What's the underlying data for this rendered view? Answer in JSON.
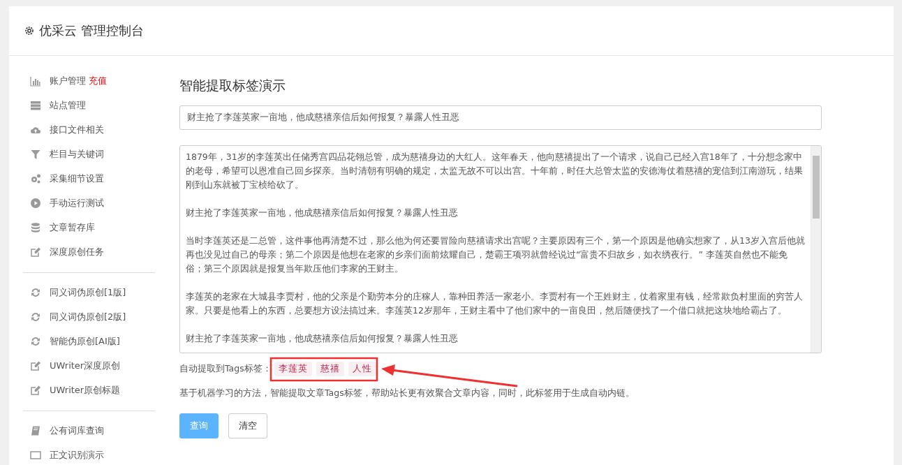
{
  "header": {
    "title": "优采云 管理控制台"
  },
  "sidebar": {
    "groups": [
      [
        {
          "label": "账户管理",
          "badge": "充值"
        },
        {
          "label": "站点管理"
        },
        {
          "label": "接口文件相关"
        },
        {
          "label": "栏目与关键词"
        },
        {
          "label": "采集细节设置"
        },
        {
          "label": "手动运行测试"
        },
        {
          "label": "文章暂存库"
        },
        {
          "label": "深度原创任务"
        }
      ],
      [
        {
          "label": "同义词伪原创[1版]"
        },
        {
          "label": "同义词伪原创[2版]"
        },
        {
          "label": "智能伪原创[AI版]"
        },
        {
          "label": "UWriter深度原创"
        },
        {
          "label": "UWriter原创标题"
        }
      ],
      [
        {
          "label": "公有词库查询"
        },
        {
          "label": "正文识别演示"
        }
      ]
    ]
  },
  "main": {
    "heading": "智能提取标签演示",
    "title_field": {
      "value": "财主抢了李莲英家一亩地，他成慈禧亲信后如何报复？暴露人性丑恶"
    },
    "content_field": {
      "paragraphs": [
        "1879年，31岁的李莲英出任储秀宫四品花翎总管，成为慈禧身边的大红人。这年春天，他向慈禧提出了一个请求，说自己已经入宫18年了，十分想念家中的老母，希望可以恩准自己回乡探亲。当时清朝有明确的规定，太监无故不可以出宫。十年前，时任大总管太监的安德海仗着慈禧的宠信到江南游玩，结果刚到山东就被丁宝桢给砍了。",
        "财主抢了李莲英家一亩地，他成慈禧亲信后如何报复？暴露人性丑恶",
        "当时李莲英还是二总管，这件事他再清楚不过，那么他为何还要冒险向慈禧请求出宫呢？主要原因有三个，第一个原因是他确实想家了，从13岁入宫后他就再也没见过自己的母亲；第二个原因是他想在老家的乡亲们面前炫耀自己，楚霸王项羽就曾经说过“富贵不归故乡，如衣绣夜行。” 李莲英自然也不能免俗；第三个原因就是报复当年欺压他们李家的王财主。",
        "李莲英的老家在大城县李贾村，他的父亲是个勤劳本分的庄稼人，靠种田养活一家老小。李贾村有一个王姓财主，仗着家里有钱，经常欺负村里面的穷苦人家。只要是他看上的东西，总要想方设法搞过来。李莲英12岁那年，王财主看中了他们家中的一亩良田，然后随便找了一个借口就把这块地给霸占了。",
        "财主抢了李莲英家一亩地，他成慈禧亲信后如何报复？暴露人性丑恶"
      ]
    },
    "tags_label": "自动提取到Tags标签：",
    "tags": [
      "李莲英",
      "慈禧",
      "人性"
    ],
    "description": "基于机器学习的方法，智能提取文章Tags标签，帮助站长更有效聚合文章内容，同时，此标签用于生成自动内链。",
    "buttons": [
      {
        "label": "查询",
        "kind": "primary"
      },
      {
        "label": "清空",
        "kind": "default"
      }
    ]
  }
}
